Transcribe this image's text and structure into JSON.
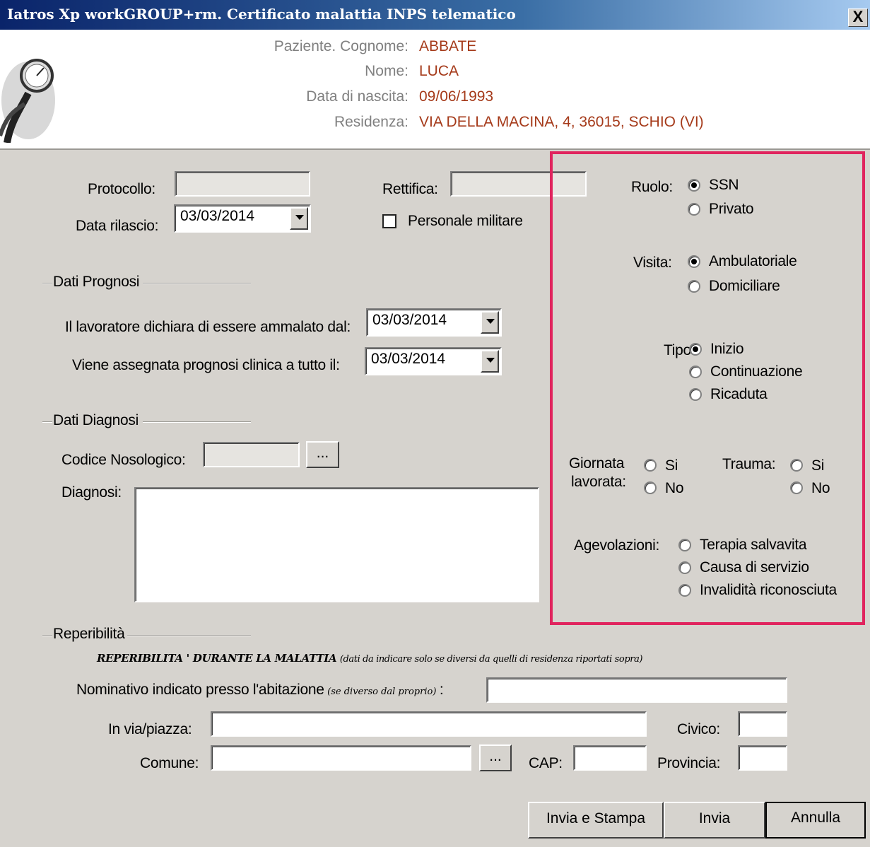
{
  "window": {
    "title": "Iatros Xp workGROUP+rm. Certificato malattia INPS telematico",
    "close_label": "X"
  },
  "header": {
    "cognome_label": "Paziente. Cognome:",
    "cognome_value": "ABBATE",
    "nome_label": "Nome:",
    "nome_value": "LUCA",
    "nascita_label": "Data di nascita:",
    "nascita_value": "09/06/1993",
    "residenza_label": "Residenza:",
    "residenza_value": "VIA DELLA MACINA, 4, 36015, SCHIO (VI)"
  },
  "form": {
    "protocollo_label": "Protocollo:",
    "protocollo_value": "",
    "rettifica_label": "Rettifica:",
    "rettifica_value": "",
    "data_rilascio_label": "Data rilascio:",
    "data_rilascio_value": "03/03/2014",
    "militare_label": "Personale militare",
    "militare_checked": false
  },
  "prognosi": {
    "group_label": "Dati Prognosi",
    "ammalato_label": "Il lavoratore dichiara di essere ammalato dal:",
    "ammalato_value": "03/03/2014",
    "prognosi_label": "Viene assegnata prognosi clinica a tutto il:",
    "prognosi_value": "03/03/2014"
  },
  "diagnosi": {
    "group_label": "Dati Diagnosi",
    "codice_label": "Codice Nosologico:",
    "codice_value": "",
    "browse_label": "...",
    "diagnosi_label": "Diagnosi:",
    "diagnosi_value": ""
  },
  "options": {
    "ruolo_label": "Ruolo:",
    "ruolo": [
      "SSN",
      "Privato"
    ],
    "ruolo_selected": "SSN",
    "visita_label": "Visita:",
    "visita": [
      "Ambulatoriale",
      "Domiciliare"
    ],
    "visita_selected": "Ambulatoriale",
    "tipo_label": "Tipo:",
    "tipo": [
      "Inizio",
      "Continuazione",
      "Ricaduta"
    ],
    "tipo_selected": "Inizio",
    "giornata_label_1": "Giornata",
    "giornata_label_2": "lavorata:",
    "giornata": [
      "Si",
      "No"
    ],
    "trauma_label": "Trauma:",
    "trauma": [
      "Si",
      "No"
    ],
    "agevolazioni_label": "Agevolazioni:",
    "agevolazioni": [
      "Terapia salvavita",
      "Causa di servizio",
      "Invalidità riconosciuta"
    ],
    "highlight_color": "#e0245e"
  },
  "reperibilita": {
    "group_label": "Reperibilità",
    "heading_bold": "REPERIBILITA ' DURANTE LA MALATTIA",
    "heading_note": "(dati da indicare solo se diversi da quelli di residenza riportati sopra)",
    "nominativo_label": "Nominativo indicato presso l'abitazione",
    "nominativo_note": "(se diverso dal proprio)",
    "nominativo_colon": ":",
    "via_label": "In via/piazza:",
    "civico_label": "Civico:",
    "comune_label": "Comune:",
    "comune_browse": "...",
    "cap_label": "CAP:",
    "provincia_label": "Provincia:"
  },
  "buttons": {
    "invia_stampa": "Invia e Stampa",
    "invia": "Invia",
    "annulla": "Annulla"
  }
}
